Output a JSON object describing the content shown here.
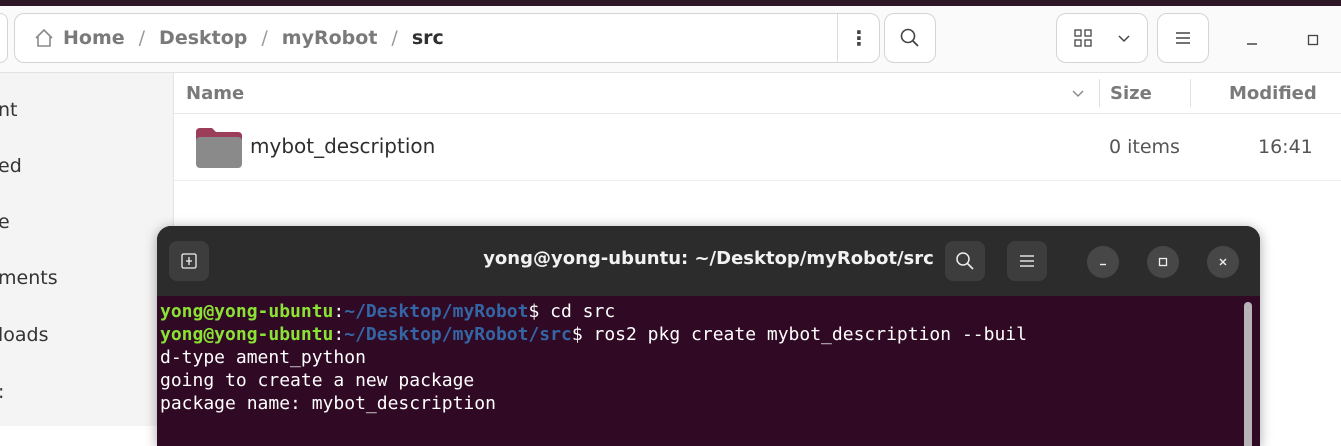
{
  "file_manager": {
    "breadcrumbs": [
      "Home",
      "Desktop",
      "myRobot",
      "src"
    ],
    "sidebar_items": [
      "nt",
      "ed",
      "e",
      "ments",
      "loads",
      ":"
    ],
    "columns": {
      "name": "Name",
      "size": "Size",
      "modified": "Modified"
    },
    "rows": [
      {
        "name": "mybot_description",
        "size": "0 items",
        "modified": "16:41"
      }
    ]
  },
  "terminal": {
    "title": "yong@yong-ubuntu: ~/Desktop/myRobot/src",
    "lines": [
      {
        "user": "yong@yong-ubuntu",
        "colon": ":",
        "path": "~/Desktop/myRobot",
        "cmd": "$ cd src"
      },
      {
        "user": "yong@yong-ubuntu",
        "colon": ":",
        "path": "~/Desktop/myRobot/src",
        "cmd": "$ ros2 pkg create mybot_description --buil"
      }
    ],
    "output": [
      "d-type ament_python",
      "going to create a new package",
      "package name: mybot_description"
    ]
  },
  "colors": {
    "terminal_bg": "#300a24",
    "prompt_user": "#8ae234",
    "prompt_path": "#3465a4",
    "folder": "#8a8a8a",
    "folder_tab": "#9c3d5a"
  },
  "icons": [
    "home-icon",
    "menu-dots-icon",
    "search-icon",
    "grid-view-icon",
    "chevron-down-icon",
    "hamburger-menu-icon",
    "minimize-icon",
    "maximize-icon",
    "close-icon",
    "new-tab-icon",
    "folder-icon"
  ]
}
